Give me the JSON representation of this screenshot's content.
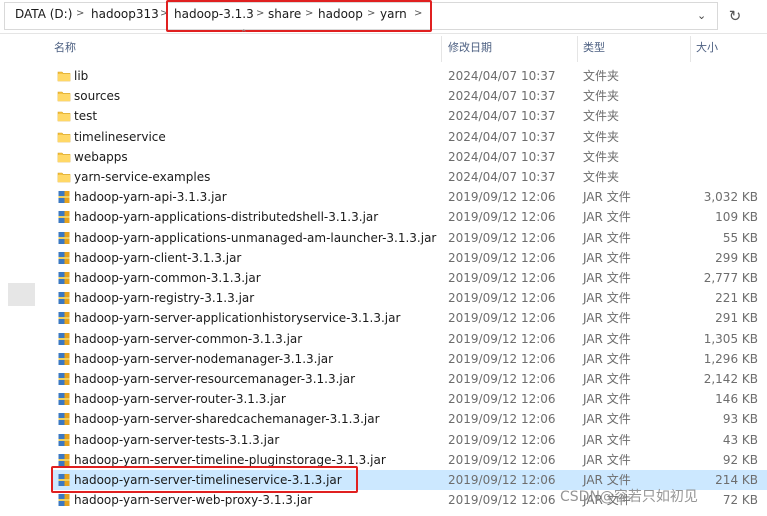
{
  "address": {
    "crumbs": [
      "DATA (D:)",
      "hadoop313",
      "hadoop-3.1.3",
      "share",
      "hadoop",
      "yarn"
    ],
    "separator": ">"
  },
  "columns": {
    "name": "名称",
    "date": "修改日期",
    "type": "类型",
    "size": "大小"
  },
  "rows": [
    {
      "name": "lib",
      "date": "2024/04/07 10:37",
      "type": "文件夹",
      "size": "",
      "icon": "folder-icon"
    },
    {
      "name": "sources",
      "date": "2024/04/07 10:37",
      "type": "文件夹",
      "size": "",
      "icon": "folder-icon"
    },
    {
      "name": "test",
      "date": "2024/04/07 10:37",
      "type": "文件夹",
      "size": "",
      "icon": "folder-icon"
    },
    {
      "name": "timelineservice",
      "date": "2024/04/07 10:37",
      "type": "文件夹",
      "size": "",
      "icon": "folder-icon"
    },
    {
      "name": "webapps",
      "date": "2024/04/07 10:37",
      "type": "文件夹",
      "size": "",
      "icon": "folder-icon"
    },
    {
      "name": "yarn-service-examples",
      "date": "2024/04/07 10:37",
      "type": "文件夹",
      "size": "",
      "icon": "folder-icon"
    },
    {
      "name": "hadoop-yarn-api-3.1.3.jar",
      "date": "2019/09/12 12:06",
      "type": "JAR 文件",
      "size": "3,032 KB",
      "icon": "jar-file-icon"
    },
    {
      "name": "hadoop-yarn-applications-distributedshell-3.1.3.jar",
      "date": "2019/09/12 12:06",
      "type": "JAR 文件",
      "size": "109 KB",
      "icon": "jar-file-icon"
    },
    {
      "name": "hadoop-yarn-applications-unmanaged-am-launcher-3.1.3.jar",
      "date": "2019/09/12 12:06",
      "type": "JAR 文件",
      "size": "55 KB",
      "icon": "jar-file-icon"
    },
    {
      "name": "hadoop-yarn-client-3.1.3.jar",
      "date": "2019/09/12 12:06",
      "type": "JAR 文件",
      "size": "299 KB",
      "icon": "jar-file-icon"
    },
    {
      "name": "hadoop-yarn-common-3.1.3.jar",
      "date": "2019/09/12 12:06",
      "type": "JAR 文件",
      "size": "2,777 KB",
      "icon": "jar-file-icon"
    },
    {
      "name": "hadoop-yarn-registry-3.1.3.jar",
      "date": "2019/09/12 12:06",
      "type": "JAR 文件",
      "size": "221 KB",
      "icon": "jar-file-icon"
    },
    {
      "name": "hadoop-yarn-server-applicationhistoryservice-3.1.3.jar",
      "date": "2019/09/12 12:06",
      "type": "JAR 文件",
      "size": "291 KB",
      "icon": "jar-file-icon"
    },
    {
      "name": "hadoop-yarn-server-common-3.1.3.jar",
      "date": "2019/09/12 12:06",
      "type": "JAR 文件",
      "size": "1,305 KB",
      "icon": "jar-file-icon"
    },
    {
      "name": "hadoop-yarn-server-nodemanager-3.1.3.jar",
      "date": "2019/09/12 12:06",
      "type": "JAR 文件",
      "size": "1,296 KB",
      "icon": "jar-file-icon"
    },
    {
      "name": "hadoop-yarn-server-resourcemanager-3.1.3.jar",
      "date": "2019/09/12 12:06",
      "type": "JAR 文件",
      "size": "2,142 KB",
      "icon": "jar-file-icon"
    },
    {
      "name": "hadoop-yarn-server-router-3.1.3.jar",
      "date": "2019/09/12 12:06",
      "type": "JAR 文件",
      "size": "146 KB",
      "icon": "jar-file-icon"
    },
    {
      "name": "hadoop-yarn-server-sharedcachemanager-3.1.3.jar",
      "date": "2019/09/12 12:06",
      "type": "JAR 文件",
      "size": "93 KB",
      "icon": "jar-file-icon"
    },
    {
      "name": "hadoop-yarn-server-tests-3.1.3.jar",
      "date": "2019/09/12 12:06",
      "type": "JAR 文件",
      "size": "43 KB",
      "icon": "jar-file-icon"
    },
    {
      "name": "hadoop-yarn-server-timeline-pluginstorage-3.1.3.jar",
      "date": "2019/09/12 12:06",
      "type": "JAR 文件",
      "size": "92 KB",
      "icon": "jar-file-icon"
    },
    {
      "name": "hadoop-yarn-server-timelineservice-3.1.3.jar",
      "date": "2019/09/12 12:06",
      "type": "JAR 文件",
      "size": "214 KB",
      "icon": "jar-file-icon",
      "selected": true
    },
    {
      "name": "hadoop-yarn-server-web-proxy-3.1.3.jar",
      "date": "2019/09/12 12:06",
      "type": "JAR 文件",
      "size": "72 KB",
      "icon": "jar-file-icon"
    }
  ],
  "watermark": "CSDN@容若只如初见",
  "colors": {
    "selection": "#cce8ff",
    "highlight_box": "#e02020",
    "folder": "#f5c242"
  }
}
